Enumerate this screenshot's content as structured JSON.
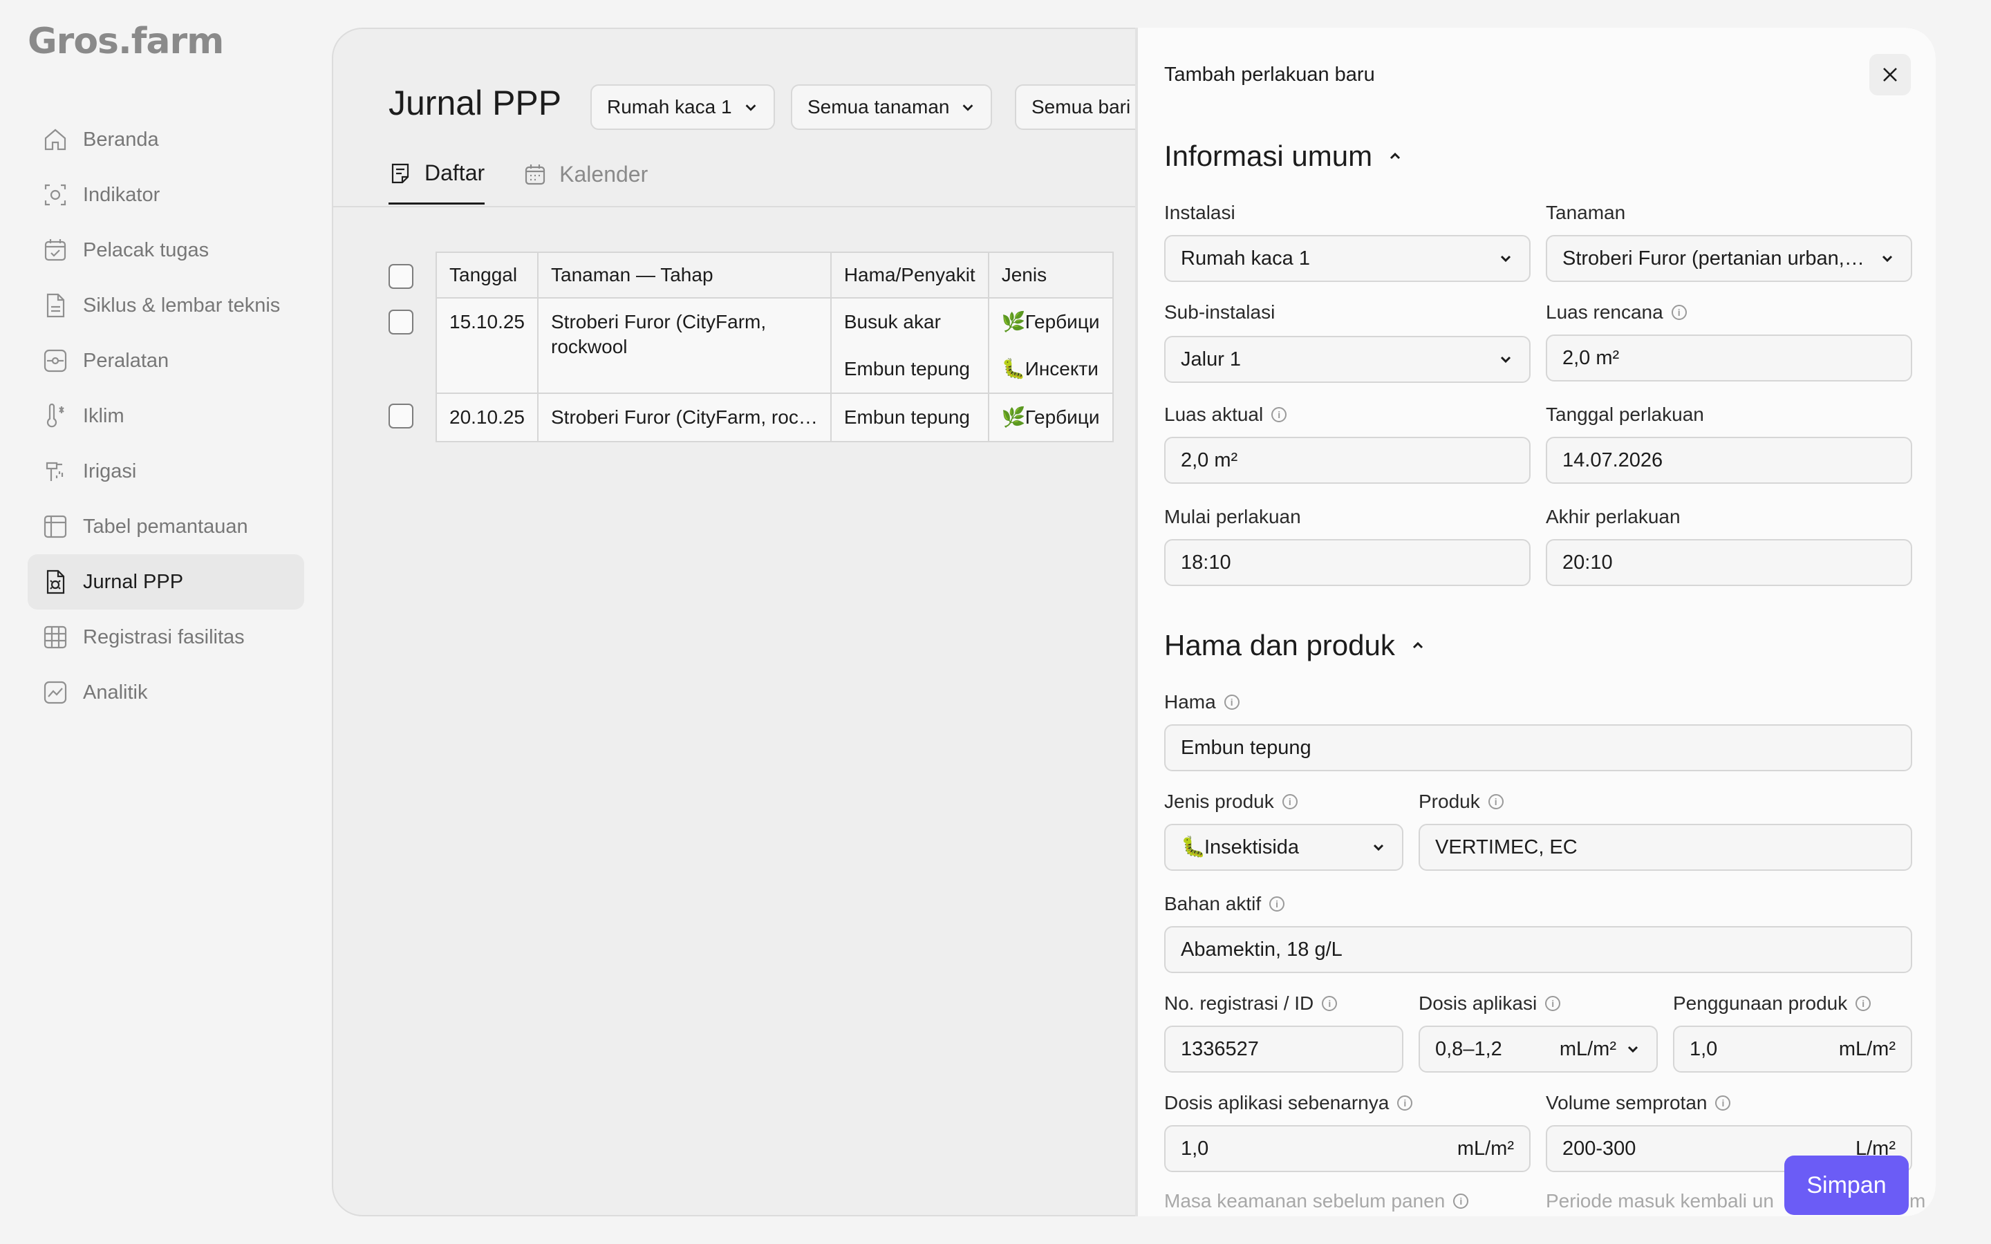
{
  "logo": "Gros.farm",
  "sidebar": {
    "items": [
      {
        "label": "Beranda",
        "icon": "home-icon"
      },
      {
        "label": "Indikator",
        "icon": "indicator-icon"
      },
      {
        "label": "Pelacak tugas",
        "icon": "calendar-check-icon"
      },
      {
        "label": "Siklus & lembar teknis",
        "icon": "document-icon"
      },
      {
        "label": "Peralatan",
        "icon": "equipment-icon"
      },
      {
        "label": "Iklim",
        "icon": "thermometer-icon"
      },
      {
        "label": "Irigasi",
        "icon": "irrigation-icon"
      },
      {
        "label": "Tabel pemantauan",
        "icon": "table-icon"
      },
      {
        "label": "Jurnal PPP",
        "icon": "journal-icon",
        "active": true
      },
      {
        "label": "Registrasi fasilitas",
        "icon": "grid-icon"
      },
      {
        "label": "Analitik",
        "icon": "analytics-icon"
      }
    ]
  },
  "main": {
    "title": "Jurnal PPP",
    "filters": [
      "Rumah kaca 1",
      "Semua tanaman",
      "Semua bari"
    ],
    "tabs": [
      {
        "label": "Daftar",
        "icon": "list-icon",
        "active": true
      },
      {
        "label": "Kalender",
        "icon": "calendar-icon"
      }
    ],
    "table": {
      "headers": [
        "Tanggal",
        "Tanaman — Tahap",
        "Hama/Penyakit",
        "Jenis"
      ],
      "rows": [
        {
          "date": "15.10.25",
          "crop_line1": "Stroberi Furor (CityFarm,",
          "crop_line2": "rockwool",
          "pest1": "Busuk akar",
          "pest2": "Embun tepung",
          "type1": "Гербици",
          "type1_icon": "🌿",
          "type2": "Инсекти",
          "type2_icon": "🐛"
        },
        {
          "date": "20.10.25",
          "crop": "Stroberi Furor (CityFarm, roc…",
          "pest": "Embun tepung",
          "type": "Гербици",
          "type_icon": "🌿"
        }
      ]
    }
  },
  "drawer": {
    "title": "Tambah perlakuan baru",
    "section1": "Informasi umum",
    "section2": "Hama dan produk",
    "fields": {
      "instalasi": {
        "label": "Instalasi",
        "value": "Rumah kaca 1"
      },
      "tanaman": {
        "label": "Tanaman",
        "value": "Stroberi Furor (pertanian urban,…"
      },
      "sub_instalasi": {
        "label": "Sub-instalasi",
        "value": "Jalur 1"
      },
      "luas_rencana": {
        "label": "Luas rencana",
        "value": "2,0 m²"
      },
      "luas_aktual": {
        "label": "Luas aktual",
        "value": "2,0 m²"
      },
      "tanggal": {
        "label": "Tanggal perlakuan",
        "value": "14.07.2026"
      },
      "mulai": {
        "label": "Mulai perlakuan",
        "value": "18:10"
      },
      "akhir": {
        "label": "Akhir perlakuan",
        "value": "20:10"
      },
      "hama": {
        "label": "Hama",
        "value": "Embun tepung"
      },
      "jenis_produk": {
        "label": "Jenis produk",
        "value": "Insektisida",
        "icon": "🐛"
      },
      "produk": {
        "label": "Produk",
        "value": "VERTIMEC, EC"
      },
      "bahan_aktif": {
        "label": "Bahan aktif",
        "value": "Abamektin, 18 g/L"
      },
      "no_registrasi": {
        "label": "No. registrasi / ID",
        "value": "1336527"
      },
      "dosis": {
        "label": "Dosis aplikasi",
        "value": "0,8–1,2",
        "unit": "mL/m²"
      },
      "penggunaan": {
        "label": "Penggunaan produk",
        "value": "1,0",
        "unit": "mL/m²"
      },
      "dosis_sebenarnya": {
        "label": "Dosis aplikasi sebenarnya",
        "value": "1,0",
        "unit": "mL/m²"
      },
      "volume": {
        "label": "Volume semprotan",
        "value": "200-300",
        "unit": "L/m²"
      },
      "masa_keamanan": {
        "label": "Masa keamanan sebelum panen"
      },
      "periode_masuk": {
        "label": "Periode masuk kembali un",
        "suffix": "m"
      }
    },
    "save_label": "Simpan"
  },
  "colors": {
    "accent": "#6b5cf6",
    "background": "#f4f4f4"
  }
}
